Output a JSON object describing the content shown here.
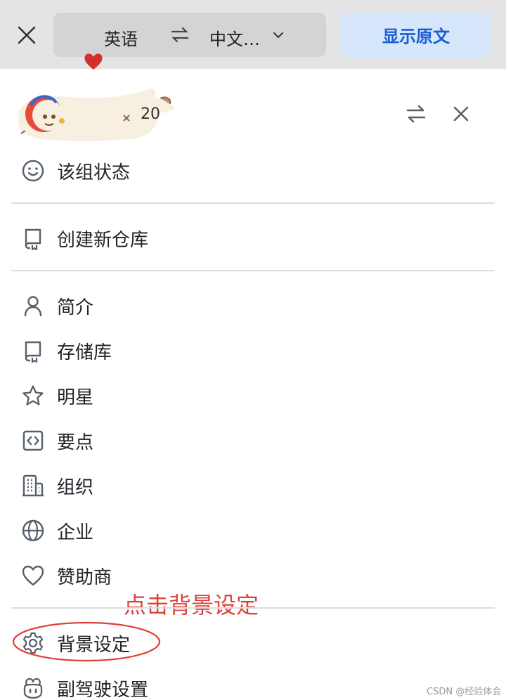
{
  "translate_bar": {
    "source_language": "英语",
    "target_language": "中文…",
    "show_original_label": "显示原文"
  },
  "user": {
    "username_partial": "20"
  },
  "menu": {
    "status": "该组状态",
    "new_repo": "创建新仓库",
    "items": [
      {
        "label": "简介",
        "icon": "person-icon"
      },
      {
        "label": "存储库",
        "icon": "repo-icon"
      },
      {
        "label": "明星",
        "icon": "star-icon"
      },
      {
        "label": "要点",
        "icon": "code-square-icon"
      },
      {
        "label": "组织",
        "icon": "organization-icon"
      },
      {
        "label": "企业",
        "icon": "globe-icon"
      },
      {
        "label": "赞助商",
        "icon": "heart-icon"
      }
    ],
    "settings": "背景设定",
    "copilot": "副驾驶设置"
  },
  "annotation": {
    "text": "点击背景设定",
    "color": "#e0403a"
  },
  "watermark": "CSDN @经验体会",
  "colors": {
    "accent": "#1b5cd6",
    "icon": "#57606a",
    "divider": "#d8dee4"
  }
}
